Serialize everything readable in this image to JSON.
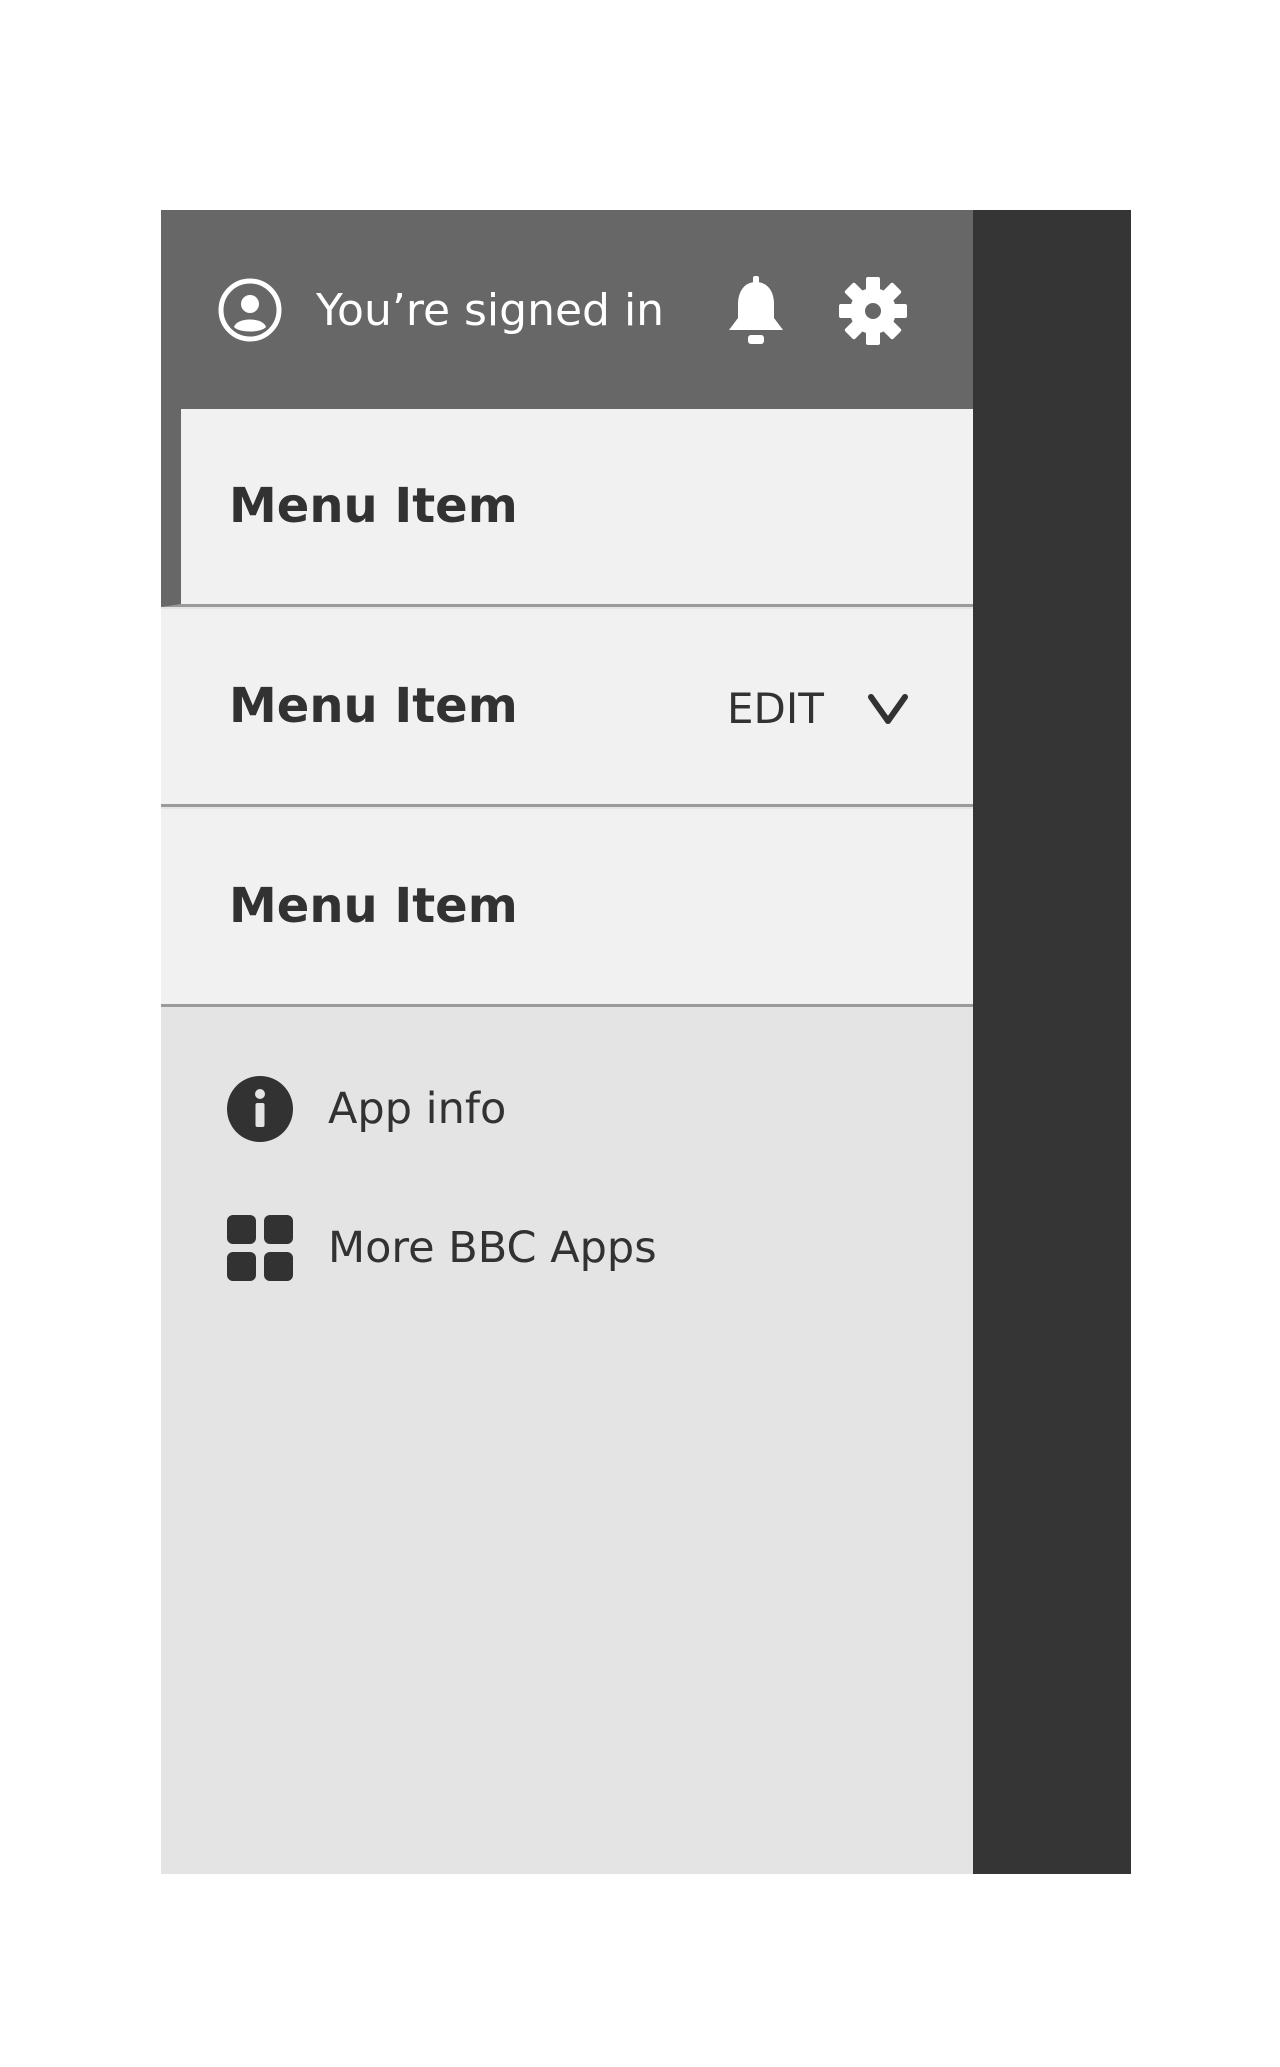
{
  "header": {
    "signed_in_label": "You’re signed in"
  },
  "menu": {
    "items": [
      {
        "label": "Menu Item",
        "selected": true
      },
      {
        "label": "Menu Item",
        "action_label": "EDIT"
      },
      {
        "label": "Menu Item"
      }
    ]
  },
  "footer": {
    "links": [
      {
        "label": "App info",
        "icon": "info-icon"
      },
      {
        "label": "More BBC Apps",
        "icon": "apps-grid-icon"
      }
    ]
  },
  "colors": {
    "header_bg": "#676767",
    "menu_bg": "#f1f1f1",
    "drawer_bg": "#e4e4e4",
    "scrim": "#353535",
    "text": "#323232"
  }
}
